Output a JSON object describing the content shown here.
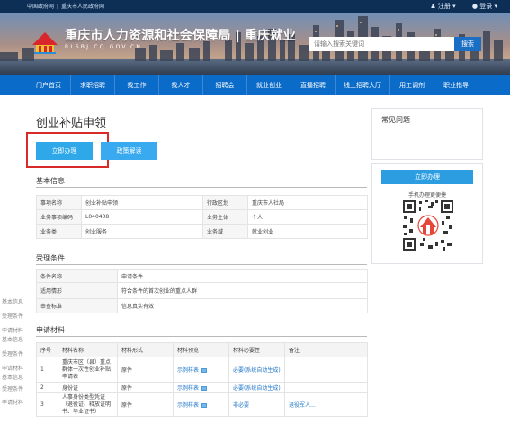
{
  "topbar": {
    "links": [
      "中国政府网",
      "|",
      "重庆市人民政府网"
    ],
    "register": "注册",
    "login": "登录"
  },
  "banner": {
    "title": "重庆市人力资源和社会保障局",
    "divider": "|",
    "subtitle": "重庆就业",
    "domain": "RLSBJ.CQ.GOV.CN",
    "search_placeholder": "请输入搜索关键词",
    "search_button": "搜索"
  },
  "nav": {
    "items": [
      "门户首页",
      "求职招聘",
      "找工作",
      "找人才",
      "招聘会",
      "就业创业",
      "直播招聘",
      "线上招聘大厅",
      "用工调剂",
      "职业指导"
    ]
  },
  "page": {
    "title": "创业补贴申领",
    "apply_button": "立即办理",
    "policy_button": "政策解读"
  },
  "basic_info": {
    "heading": "基本信息",
    "rows": [
      [
        "事项名称",
        "创业补贴申领",
        "行政区划",
        "重庆市人社局"
      ],
      [
        "业务事项编码",
        "L040408",
        "业务主体",
        "个人"
      ],
      [
        "业务类",
        "创业服务",
        "业务域",
        "就业创业"
      ]
    ]
  },
  "conditions": {
    "heading": "受理条件",
    "rows": [
      [
        "条件名称",
        "申请条件"
      ],
      [
        "适用情形",
        "符合条件的首次创业的重点人群"
      ],
      [
        "审查标准",
        "信息真实有效"
      ]
    ]
  },
  "materials": {
    "heading": "申请材料",
    "headers": [
      "序号",
      "材料名称",
      "材料形式",
      "材料预览",
      "材料必要性",
      "备注"
    ],
    "rows": [
      [
        "1",
        "重庆市区（县）重点群体一次性创业补贴申请表",
        "原件",
        "示例样表",
        "必要(系统自动生成)",
        ""
      ],
      [
        "2",
        "身份证",
        "原件",
        "示例样表",
        "必要(系统自动生成)",
        ""
      ],
      [
        "3",
        "人事身份类型凭证（退役证、释放证明书、毕业证书）",
        "原件",
        "示例样表",
        "非必要",
        "退役军人..."
      ]
    ]
  },
  "sidebar_left": {
    "items": [
      "基本信息",
      "受理条件",
      "申请材料",
      "基本信息",
      "受理条件",
      "申请材料",
      "基本信息",
      "受理条件",
      "申请材料"
    ]
  },
  "right": {
    "faq_title": "常见问题",
    "apply_button": "立即办理",
    "qr_caption": "手机办理更便捷"
  }
}
